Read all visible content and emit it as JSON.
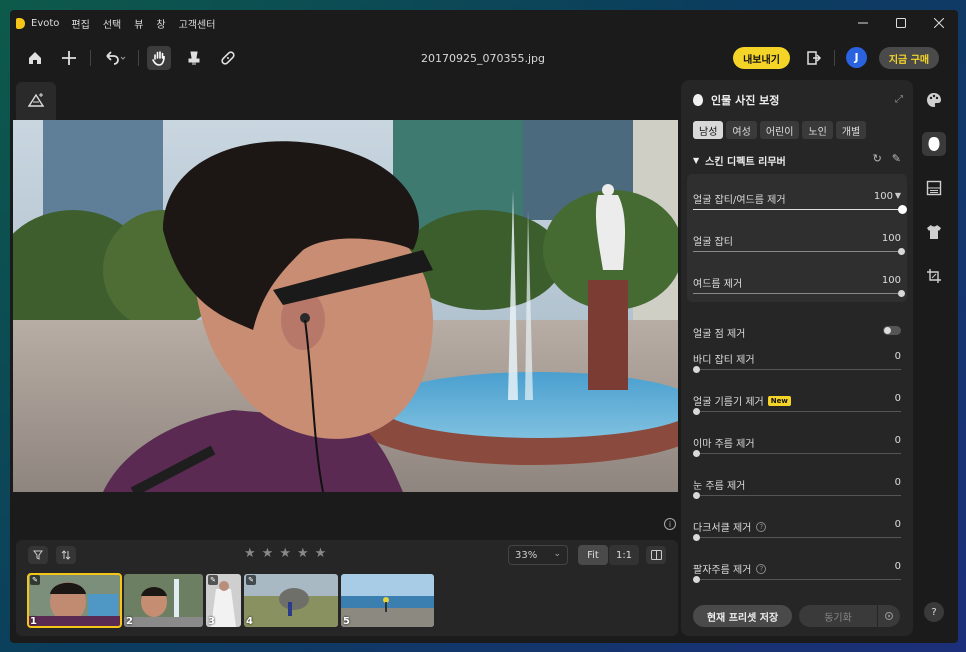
{
  "app": {
    "name": "Evoto",
    "menu": [
      "편집",
      "선택",
      "뷰",
      "창",
      "고객센터"
    ],
    "file_title": "20170925_070355.jpg"
  },
  "toolbar": {
    "export_label": "내보내기",
    "avatar_initial": "J",
    "buy_label": "지금 구매"
  },
  "filmstrip": {
    "zoom_value": "33%",
    "fit_label": "Fit",
    "one_to_one_label": "1:1",
    "rating_stars": 5,
    "thumbs": [
      {
        "num": "1",
        "selected": true
      },
      {
        "num": "2",
        "selected": false
      },
      {
        "num": "3",
        "selected": false
      },
      {
        "num": "4",
        "selected": false
      },
      {
        "num": "5",
        "selected": false
      }
    ]
  },
  "panel": {
    "title": "인물 사진 보정",
    "tabs": [
      "남성",
      "여성",
      "어린이",
      "노인",
      "개별"
    ],
    "active_tab": "남성",
    "section_title": "스킨 디펙트 리무버",
    "sliders": [
      {
        "label": "얼굴 잡티/여드름 제거",
        "value": "100",
        "level": 1.0
      },
      {
        "label": "얼굴 잡티",
        "value": "100",
        "level": 1.0
      },
      {
        "label": "여드름 제거",
        "value": "100",
        "level": 1.0
      }
    ],
    "toggle_label": "얼굴 점 제거",
    "sliders2": [
      {
        "label": "바디 잡티 제거",
        "value": "0"
      },
      {
        "label": "얼굴 기름기 제거",
        "value": "0",
        "badge": "New"
      },
      {
        "label": "이마 주름 제거",
        "value": "0"
      },
      {
        "label": "눈 주름 제거",
        "value": "0"
      },
      {
        "label": "다크서클 제거",
        "value": "0",
        "help": true
      },
      {
        "label": "팔자주름 제거",
        "value": "0",
        "help": true
      }
    ],
    "save_preset_label": "현재 프리셋 저장",
    "sync_label": "동기화"
  }
}
